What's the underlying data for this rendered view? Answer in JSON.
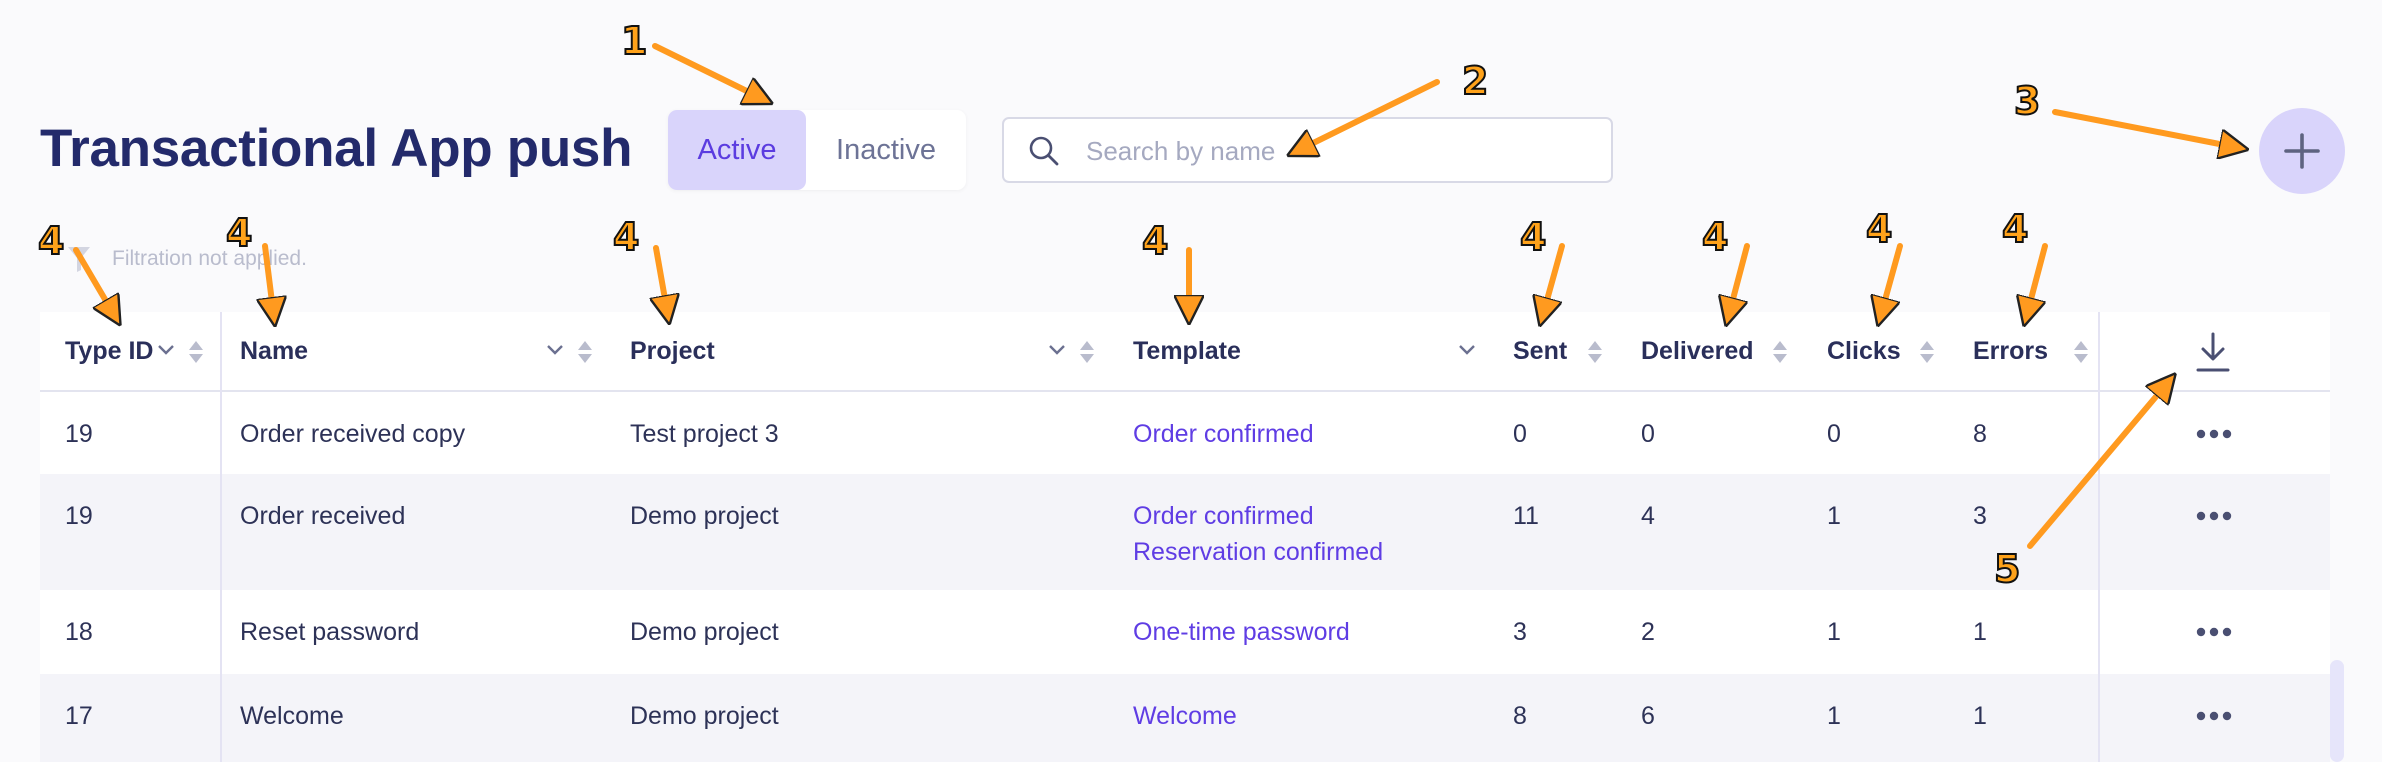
{
  "page": {
    "title": "Transactional App push"
  },
  "status_toggle": {
    "active_label": "Active",
    "inactive_label": "Inactive",
    "selected": "Active"
  },
  "search": {
    "placeholder": "Search by name",
    "value": ""
  },
  "filter": {
    "status_text": "Filtration not applied."
  },
  "table": {
    "columns": [
      {
        "key": "type_id",
        "label": "Type ID"
      },
      {
        "key": "name",
        "label": "Name"
      },
      {
        "key": "project",
        "label": "Project"
      },
      {
        "key": "template",
        "label": "Template"
      },
      {
        "key": "sent",
        "label": "Sent"
      },
      {
        "key": "delivered",
        "label": "Delivered"
      },
      {
        "key": "clicks",
        "label": "Clicks"
      },
      {
        "key": "errors",
        "label": "Errors"
      }
    ],
    "rows": [
      {
        "type_id": "19",
        "name": "Order received copy",
        "project": "Test project 3",
        "templates": [
          "Order confirmed"
        ],
        "sent": "0",
        "delivered": "0",
        "clicks": "0",
        "errors": "8"
      },
      {
        "type_id": "19",
        "name": "Order received",
        "project": "Demo project",
        "templates": [
          "Order confirmed",
          "Reservation confirmed"
        ],
        "sent": "11",
        "delivered": "4",
        "clicks": "1",
        "errors": "3"
      },
      {
        "type_id": "18",
        "name": "Reset password",
        "project": "Demo project",
        "templates": [
          "One-time password"
        ],
        "sent": "3",
        "delivered": "2",
        "clicks": "1",
        "errors": "1"
      },
      {
        "type_id": "17",
        "name": "Welcome",
        "project": "Demo project",
        "templates": [
          "Welcome"
        ],
        "sent": "8",
        "delivered": "6",
        "clicks": "1",
        "errors": "1"
      }
    ]
  },
  "icons": {
    "search": "search-icon",
    "add": "plus-icon",
    "filter": "funnel-icon",
    "download": "download-icon",
    "more": "ellipsis-icon",
    "sort": "sort-arrows-icon",
    "dropdown": "chevron-down-icon"
  },
  "annotations": [
    "1",
    "2",
    "3",
    "4",
    "4",
    "4",
    "4",
    "4",
    "4",
    "4",
    "4",
    "5"
  ],
  "colors": {
    "title": "#232a6b",
    "accent": "#5b3ce0",
    "accent_soft": "#d9d4fb",
    "template_link": "#5f3de4",
    "row_alt": "#f4f4f9",
    "annotation": "#ffa21a"
  }
}
